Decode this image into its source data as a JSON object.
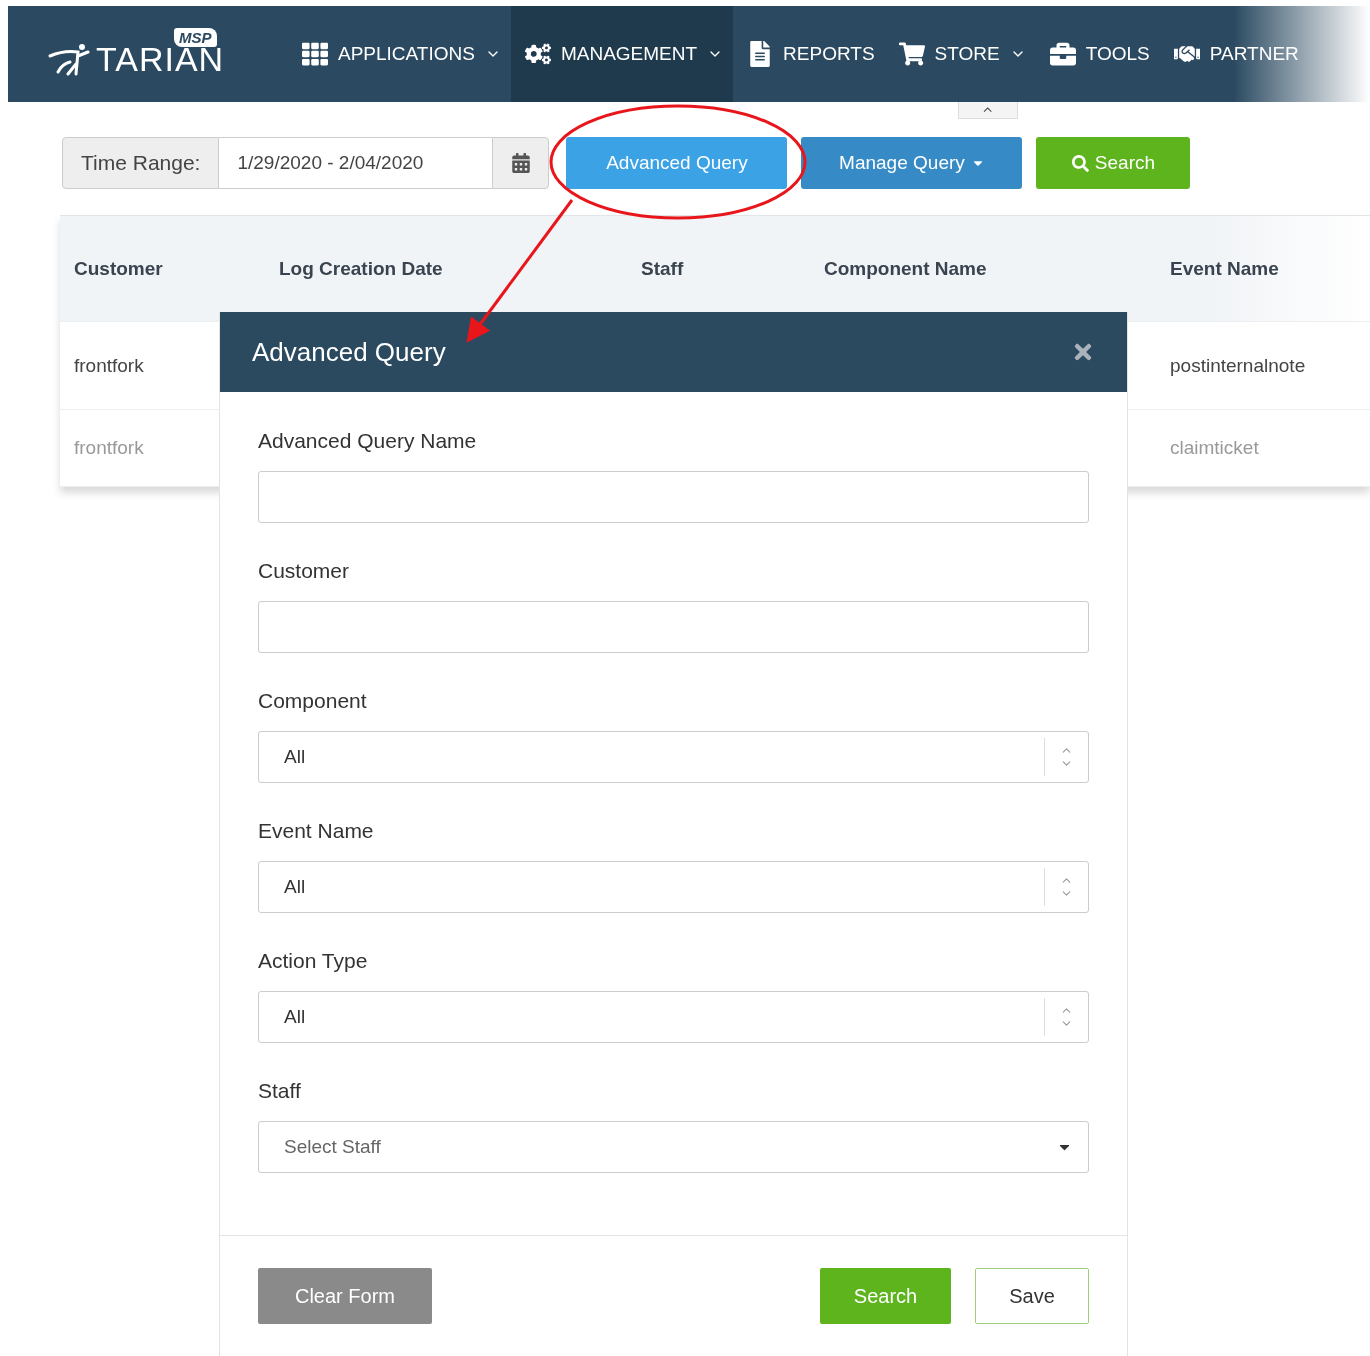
{
  "logo": {
    "badge": "MSP",
    "name": "TARIAN"
  },
  "nav": [
    {
      "label": "APPLICATIONS",
      "has_menu": true,
      "selected": false
    },
    {
      "label": "MANAGEMENT",
      "has_menu": true,
      "selected": true
    },
    {
      "label": "REPORTS",
      "has_menu": false,
      "selected": false
    },
    {
      "label": "STORE",
      "has_menu": true,
      "selected": false
    },
    {
      "label": "TOOLS",
      "has_menu": false,
      "selected": false
    },
    {
      "label": "PARTNER",
      "has_menu": false,
      "selected": false
    }
  ],
  "toolbar": {
    "time_range_label": "Time Range:",
    "time_range_value": "1/29/2020 - 2/04/2020",
    "buttons": [
      {
        "label": "Advanced Query",
        "kind": "light"
      },
      {
        "label": "Manage Query",
        "kind": "menu"
      },
      {
        "label": "Search",
        "kind": "search"
      }
    ]
  },
  "table": {
    "columns": [
      "Customer",
      "Log Creation Date",
      "Staff",
      "Component Name",
      "Event Name"
    ],
    "rows": [
      {
        "customer": "frontfork",
        "event_name": "postinternalnote",
        "faded": false
      },
      {
        "customer": "frontfork",
        "event_name": "claimticket",
        "faded": true
      }
    ]
  },
  "dialog": {
    "title": "Advanced Query",
    "fields": [
      {
        "label": "Advanced Query Name",
        "kind": "text"
      },
      {
        "label": "Customer",
        "kind": "text"
      },
      {
        "label": "Component",
        "kind": "spinner",
        "value": "All"
      },
      {
        "label": "Event Name",
        "kind": "spinner",
        "value": "All"
      },
      {
        "label": "Action Type",
        "kind": "spinner",
        "value": "All"
      },
      {
        "label": "Staff",
        "kind": "dropdown",
        "placeholder": "Select Staff"
      }
    ],
    "buttons": [
      {
        "label": "Clear Form",
        "kind": "grey"
      },
      {
        "label": "Search",
        "kind": "green"
      },
      {
        "label": "Save",
        "kind": "outline"
      }
    ]
  }
}
